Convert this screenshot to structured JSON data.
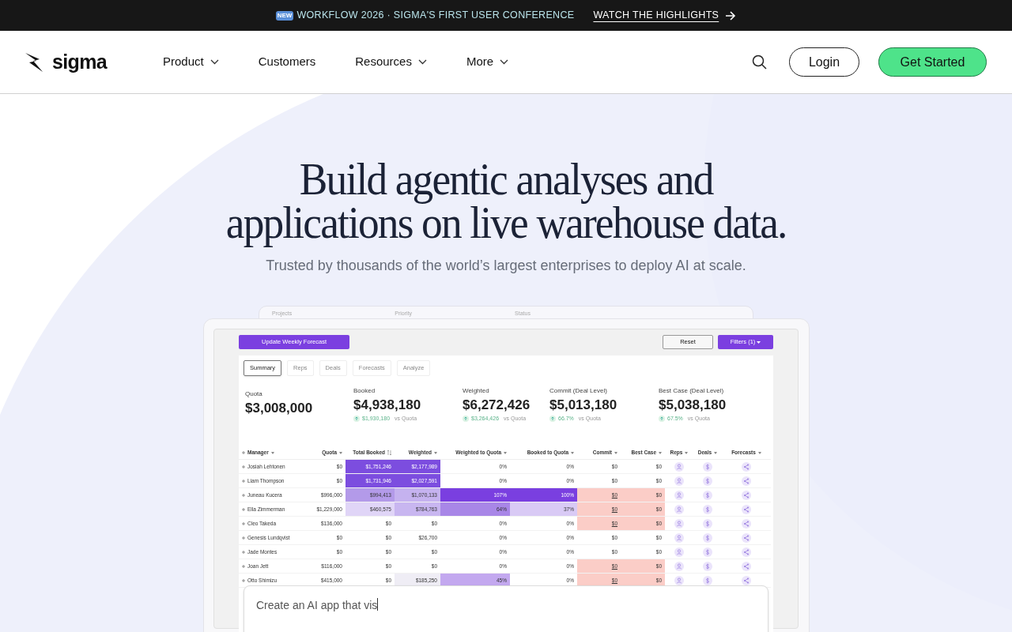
{
  "banner": {
    "badge": "NEW",
    "text": "WORKFLOW 2026 · SIGMA'S FIRST USER CONFERENCE",
    "link": "WATCH THE HIGHLIGHTS"
  },
  "nav": {
    "logo": "sigma",
    "items": [
      {
        "label": "Product",
        "dropdown": true
      },
      {
        "label": "Customers",
        "dropdown": false
      },
      {
        "label": "Resources",
        "dropdown": true
      },
      {
        "label": "More",
        "dropdown": true
      }
    ],
    "login": "Login",
    "cta": "Get Started"
  },
  "hero": {
    "title_lines": [
      "Build agentic analyses and",
      "applications on live warehouse data."
    ],
    "subtitle": "Trusted by thousands of the world’s largest enterprises to deploy AI at scale."
  },
  "dashboard": {
    "back_labels": [
      "Projects",
      "Priority",
      "Status"
    ],
    "primary_button": "Update Weekly Forecast",
    "reset": "Reset",
    "filters": "Filters (1)",
    "tabs": [
      {
        "label": "Summary",
        "selected": true
      },
      {
        "label": "Reps",
        "selected": false
      },
      {
        "label": "Deals",
        "selected": false
      },
      {
        "label": "Forecasts",
        "selected": false
      },
      {
        "label": "Analyze",
        "selected": false
      }
    ],
    "kpis": [
      {
        "label": "Quota",
        "value": "$3,008,000"
      },
      {
        "label": "Booked",
        "value": "$4,938,180",
        "delta": "$1,930,180",
        "note": "vs Quota"
      },
      {
        "label": "Weighted",
        "value": "$6,272,426",
        "delta": "$3,264,426",
        "note": "vs Quota"
      },
      {
        "label": "Commit (Deal Level)",
        "value": "$5,013,180",
        "delta": "66.7%",
        "note": "vs Quota"
      },
      {
        "label": "Best Case (Deal Level)",
        "value": "$5,038,180",
        "delta": "67.5%",
        "note": "vs Quota"
      }
    ],
    "table": {
      "columns": [
        {
          "label": "Manager",
          "kind": "menu"
        },
        {
          "label": "Quota",
          "kind": "menu"
        },
        {
          "label": "Total Booked",
          "kind": "sorted"
        },
        {
          "label": "Weighted",
          "kind": "menu"
        },
        {
          "label": "Weighted to Quota",
          "kind": "menu"
        },
        {
          "label": "Booked to Quota",
          "kind": "menu"
        },
        {
          "label": "Commit",
          "kind": "menu"
        },
        {
          "label": "Best Case",
          "kind": "menu"
        },
        {
          "label": "Reps",
          "kind": "menu"
        },
        {
          "label": "Deals",
          "kind": "menu"
        },
        {
          "label": "Forecasts",
          "kind": "menu"
        }
      ],
      "rows": [
        {
          "cells": [
            {
              "text": "Josiah Lehtonen"
            },
            {
              "text": "$0"
            },
            {
              "text": "$1,751,246",
              "color": "#7c4ddf"
            },
            {
              "text": "$2,177,989",
              "color": "#7c4ddf"
            },
            {
              "text": "0%"
            },
            {
              "text": "0%"
            },
            {
              "text": "$0"
            },
            {
              "text": "$0"
            }
          ]
        },
        {
          "cells": [
            {
              "text": "Liam Thompson"
            },
            {
              "text": "$0"
            },
            {
              "text": "$1,731,946",
              "color": "#7c4ddf"
            },
            {
              "text": "$2,027,591",
              "color": "#7c4ddf"
            },
            {
              "text": "0%"
            },
            {
              "text": "0%"
            },
            {
              "text": "$0"
            },
            {
              "text": "$0"
            }
          ]
        },
        {
          "cells": [
            {
              "text": "Juneau Kucera"
            },
            {
              "text": "$996,000"
            },
            {
              "text": "$994,413",
              "color": "#b39ae9"
            },
            {
              "text": "$1,070,133",
              "color": "#c5b2ef"
            },
            {
              "text": "107%",
              "color": "#7a3fe0"
            },
            {
              "text": "100%",
              "color": "#7a3fe0"
            },
            {
              "text": "$0",
              "color": "#fbcdc7",
              "link": true
            },
            {
              "text": "$0",
              "color": "#fbcdc7"
            }
          ]
        },
        {
          "cells": [
            {
              "text": "Ella Zimmerman"
            },
            {
              "text": "$1,229,000"
            },
            {
              "text": "$460,575",
              "color": "#e0d5f7"
            },
            {
              "text": "$784,763",
              "color": "#c8b6f0"
            },
            {
              "text": "64%",
              "color": "#a886e7"
            },
            {
              "text": "37%",
              "color": "#d9caf5"
            },
            {
              "text": "$0",
              "color": "#fbcdc7",
              "link": true
            },
            {
              "text": "$0",
              "color": "#fbcdc7"
            }
          ]
        },
        {
          "cells": [
            {
              "text": "Cleo Takeda"
            },
            {
              "text": "$136,000"
            },
            {
              "text": "$0"
            },
            {
              "text": "$0"
            },
            {
              "text": "0%"
            },
            {
              "text": "0%"
            },
            {
              "text": "$0",
              "color": "#fbcdc7",
              "link": true
            },
            {
              "text": "$0",
              "color": "#fbcdc7"
            }
          ]
        },
        {
          "cells": [
            {
              "text": "Genesis Lundqvist"
            },
            {
              "text": "$0"
            },
            {
              "text": "$0"
            },
            {
              "text": "$26,700"
            },
            {
              "text": "0%"
            },
            {
              "text": "0%"
            },
            {
              "text": "$0"
            },
            {
              "text": "$0"
            }
          ]
        },
        {
          "cells": [
            {
              "text": "Jade Montes"
            },
            {
              "text": "$0"
            },
            {
              "text": "$0"
            },
            {
              "text": "$0"
            },
            {
              "text": "0%"
            },
            {
              "text": "0%"
            },
            {
              "text": "$0"
            },
            {
              "text": "$0"
            }
          ]
        },
        {
          "cells": [
            {
              "text": "Joan Jett"
            },
            {
              "text": "$116,000"
            },
            {
              "text": "$0"
            },
            {
              "text": "$0"
            },
            {
              "text": "0%"
            },
            {
              "text": "0%"
            },
            {
              "text": "$0",
              "color": "#fbcdc7",
              "link": true
            },
            {
              "text": "$0",
              "color": "#fbcdc7"
            }
          ]
        },
        {
          "cells": [
            {
              "text": "Otto Shimizu"
            },
            {
              "text": "$415,000"
            },
            {
              "text": "$0"
            },
            {
              "text": "$185,250",
              "color": "#efedf5"
            },
            {
              "text": "45%",
              "color": "#c3a8ef"
            },
            {
              "text": "0%"
            },
            {
              "text": "$0",
              "color": "#fbcdc7",
              "link": true
            },
            {
              "text": "$0",
              "color": "#fbcdc7"
            }
          ]
        }
      ]
    },
    "prompt": {
      "value": "Create an AI app that vis"
    }
  }
}
